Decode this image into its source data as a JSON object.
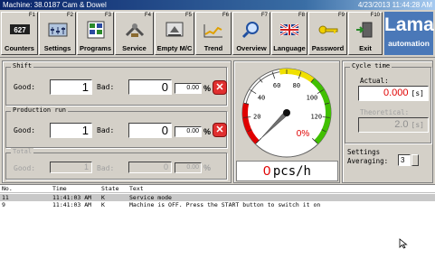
{
  "titlebar": {
    "left": "Machine: 38.0187 Cam & Dowel",
    "right": "4/23/2013 11:44:28 AM"
  },
  "toolbar": [
    {
      "key": "F1",
      "label": "Counters",
      "icon": "counter-display-icon"
    },
    {
      "key": "F2",
      "label": "Settings",
      "icon": "settings-icon"
    },
    {
      "key": "F3",
      "label": "Programs",
      "icon": "programs-icon"
    },
    {
      "key": "F4",
      "label": "Service",
      "icon": "service-icon"
    },
    {
      "key": "F5",
      "label": "Empty M/C",
      "icon": "empty-machine-icon"
    },
    {
      "key": "F6",
      "label": "Trend",
      "icon": "trend-icon"
    },
    {
      "key": "F7",
      "label": "Overview",
      "icon": "magnifier-icon"
    },
    {
      "key": "F8",
      "label": "Language",
      "icon": "uk-flag-icon"
    },
    {
      "key": "F9",
      "label": "Password",
      "icon": "key-icon"
    },
    {
      "key": "F10",
      "label": "Exit",
      "icon": "exit-door-icon"
    }
  ],
  "logo": {
    "line1": "Lama",
    "line2": "automation"
  },
  "shift": {
    "title": "Shift",
    "good_label": "Good:",
    "good": "1",
    "bad_label": "Bad:",
    "bad": "0",
    "pct": "0.00",
    "pct_sign": "%"
  },
  "production": {
    "title": "Production run",
    "good_label": "Good:",
    "good": "1",
    "bad_label": "Bad:",
    "bad": "0",
    "pct": "0.00",
    "pct_sign": "%"
  },
  "total": {
    "title": "Total",
    "good_label": "Good:",
    "good": "1",
    "bad_label": "Bad:",
    "bad": "0",
    "pct": "0.00",
    "pct_sign": "%"
  },
  "gauge": {
    "ticks": [
      "20",
      "40",
      "60",
      "80",
      "100",
      "120"
    ],
    "min": 0,
    "max": 140,
    "value": 0,
    "percent": "0%",
    "rate_value": "0",
    "rate_unit": "pcs/h",
    "colors": {
      "red": "#e00000",
      "yellow": "#f0e000",
      "green": "#40c000",
      "percent": "#e00000"
    }
  },
  "cycle": {
    "title": "Cycle time",
    "actual_label": "Actual:",
    "actual": "0.000",
    "actual_unit": "[s]",
    "theoretical_label": "Theoretical:",
    "theoretical": "2.0",
    "theoretical_unit": "[s]"
  },
  "settings": {
    "title": "Settings",
    "averaging_label": "Averaging:",
    "averaging": "3"
  },
  "log": {
    "headers": [
      "No.",
      "Time",
      "State",
      "Text"
    ],
    "rows": [
      {
        "no": "11",
        "time": "11:41:03 AM",
        "state": "K",
        "text": "Service mode"
      },
      {
        "no": "9",
        "time": "11:41:03 AM",
        "state": "K",
        "text": "Machine is OFF. Press the START button to switch it on"
      }
    ]
  }
}
